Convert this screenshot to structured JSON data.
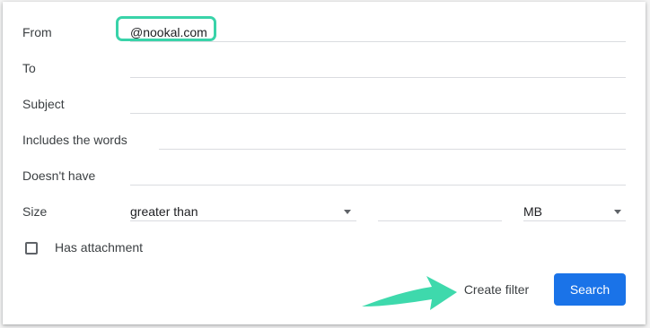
{
  "filter_form": {
    "from": {
      "label": "From",
      "value": "@nookal.com"
    },
    "to": {
      "label": "To",
      "value": ""
    },
    "subject": {
      "label": "Subject",
      "value": ""
    },
    "includes": {
      "label": "Includes the words",
      "value": ""
    },
    "doesnt_have": {
      "label": "Doesn't have",
      "value": ""
    },
    "size": {
      "label": "Size",
      "operator": "greater than",
      "amount": "",
      "unit": "MB"
    },
    "has_attachment": {
      "label": "Has attachment",
      "checked": false
    }
  },
  "actions": {
    "create_filter": "Create filter",
    "search": "Search"
  },
  "colors": {
    "accent": "#1a73e8",
    "highlight": "#39d3a9",
    "arrow": "#3ed9ac"
  },
  "icons": [
    "dropdown-caret-icon",
    "callout-arrow-icon",
    "checkbox-icon"
  ]
}
